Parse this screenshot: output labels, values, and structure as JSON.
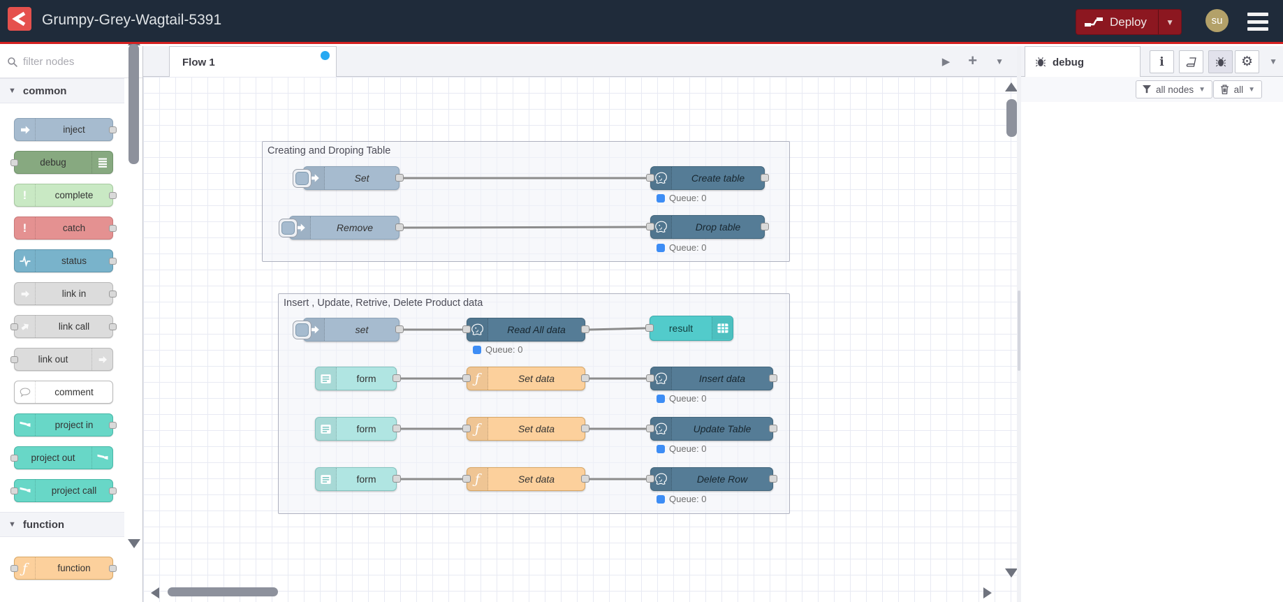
{
  "header": {
    "title": "Grumpy-Grey-Wagtail-5391",
    "deploy_label": "Deploy",
    "avatar_initials": "su"
  },
  "palette": {
    "filter_placeholder": "filter nodes",
    "sections": [
      {
        "label": "common"
      },
      {
        "label": "function"
      }
    ],
    "common_nodes": [
      {
        "label": "inject"
      },
      {
        "label": "debug"
      },
      {
        "label": "complete"
      },
      {
        "label": "catch"
      },
      {
        "label": "status"
      },
      {
        "label": "link in"
      },
      {
        "label": "link call"
      },
      {
        "label": "link out"
      },
      {
        "label": "comment"
      },
      {
        "label": "project in"
      },
      {
        "label": "project out"
      },
      {
        "label": "project call"
      }
    ],
    "function_nodes": [
      {
        "label": "function"
      }
    ]
  },
  "workspace": {
    "tab_label": "Flow 1",
    "groups": [
      {
        "title": "Creating and Droping Table",
        "nodes": {
          "set": {
            "label": "Set"
          },
          "create_table": {
            "label": "Create table",
            "status": "Queue: 0"
          },
          "remove": {
            "label": "Remove"
          },
          "drop_table": {
            "label": "Drop table",
            "status": "Queue: 0"
          }
        }
      },
      {
        "title": "Insert , Update, Retrive, Delete Product data",
        "nodes": {
          "set": {
            "label": "set"
          },
          "read_all": {
            "label": "Read All data",
            "status": "Queue: 0"
          },
          "result": {
            "label": "result"
          },
          "form1": {
            "label": "form"
          },
          "setdata1": {
            "label": "Set data"
          },
          "insert": {
            "label": "Insert data",
            "status": "Queue: 0"
          },
          "form2": {
            "label": "form"
          },
          "setdata2": {
            "label": "Set data"
          },
          "update": {
            "label": "Update Table",
            "status": "Queue: 0"
          },
          "form3": {
            "label": "form"
          },
          "setdata3": {
            "label": "Set data"
          },
          "delete": {
            "label": "Delete Row",
            "status": "Queue: 0"
          }
        }
      }
    ]
  },
  "sidebar": {
    "tab_label": "debug",
    "filter_label": "all nodes",
    "clear_label": "all"
  },
  "icons": {
    "node-red-logo-icon": "white chevron mark on red square",
    "deploy-icon": "two white blocks joined by wire",
    "menu-icon": "hamburger three bars",
    "search-icon": "magnifier",
    "inject-arrow-icon": "white arrow",
    "debug-list-icon": "white list bars",
    "exclamation-icon": "!",
    "status-pulse-icon": "heartbeat line",
    "link-arrow-icon": "white arrow",
    "comment-bubble-icon": "speech bubble",
    "project-icon": "node-red fork mark",
    "function-icon": "italic f",
    "postgres-elephant-icon": "elephant outline",
    "form-icon": "white form with lines",
    "table-icon": "white grid table",
    "info-icon": "i",
    "book-icon": "book",
    "bug-icon": "bug",
    "gear-icon": "⚙",
    "filter-funnel-icon": "funnel",
    "trash-icon": "trash can"
  },
  "colors": {
    "header_bg": "#1f2b3a",
    "accent_red": "#d42020",
    "deploy_red": "#8c1720",
    "inject": "#a6bbcf",
    "debug": "#87a980",
    "complete": "#c9e9c4",
    "catch": "#e49191",
    "status": "#79b3cb",
    "link": "#dcdcdc",
    "project": "#68d7c7",
    "function": "#fcd09c",
    "postgres": "#557c96",
    "form": "#b0e5e2",
    "result": "#52cbcb",
    "queue_dot": "#3d8df5",
    "tab_dot_blue": "#27a9f2",
    "avatar_bg": "#b3a169"
  }
}
